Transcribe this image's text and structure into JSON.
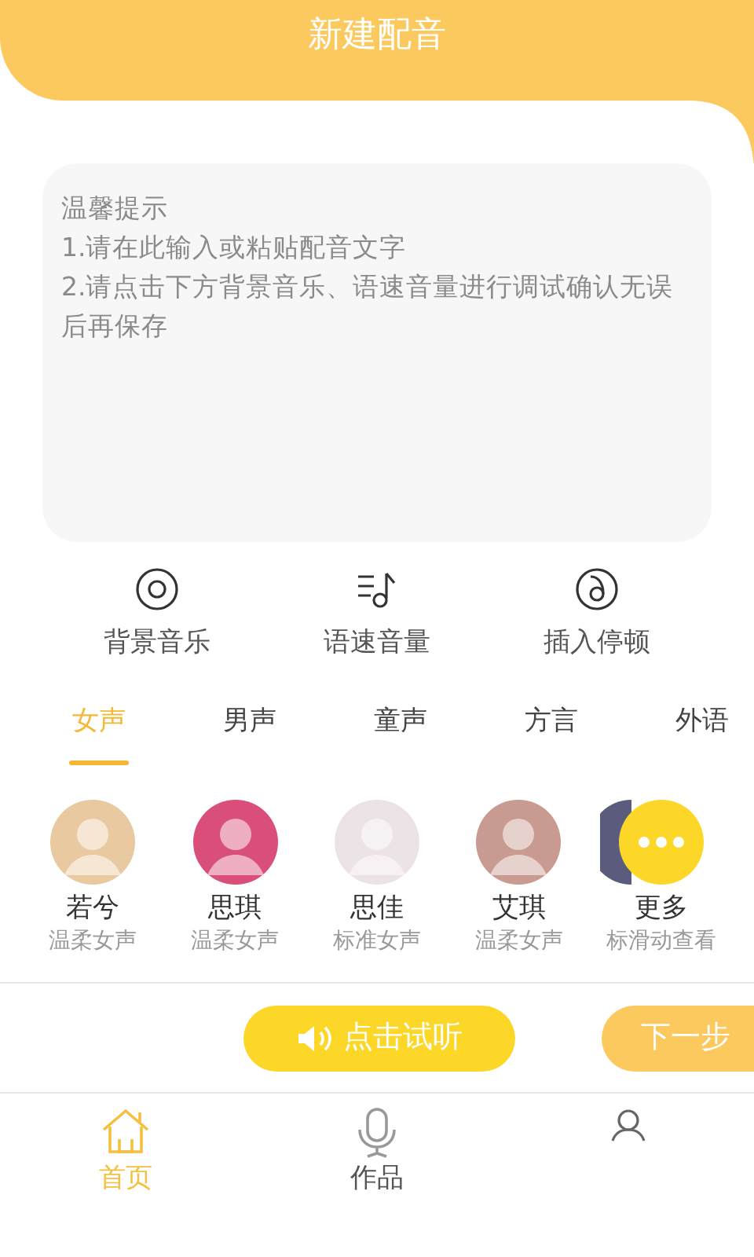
{
  "header": {
    "title": "新建配音"
  },
  "editor": {
    "placeholder": "温馨提示\n1.请在此输入或粘贴配音文字\n2.请点击下方背景音乐、语速音量进行调试确认无误后再保存"
  },
  "tools": [
    {
      "kind": "music",
      "label": "背景音乐"
    },
    {
      "kind": "speed",
      "label": "语速音量"
    },
    {
      "kind": "pause",
      "label": "插入停顿"
    }
  ],
  "tabs": [
    {
      "label": "女声",
      "selected": true
    },
    {
      "label": "男声",
      "selected": false
    },
    {
      "label": "童声",
      "selected": false
    },
    {
      "label": "方言",
      "selected": false
    },
    {
      "label": "外语",
      "selected": false
    }
  ],
  "voices": [
    {
      "kind": "voice",
      "name": "若兮",
      "style": "温柔女声",
      "color": "#e8c9a0"
    },
    {
      "kind": "voice",
      "name": "思琪",
      "style": "温柔女声",
      "color": "#d94f7a"
    },
    {
      "kind": "voice",
      "name": "思佳",
      "style": "标准女声",
      "color": "#ece3e6"
    },
    {
      "kind": "voice",
      "name": "艾琪",
      "style": "温柔女声",
      "color": "#c99a8f"
    },
    {
      "kind": "more",
      "name": "更多",
      "style": "标滑动查看",
      "color": "#5a5b7d"
    }
  ],
  "actions": [
    {
      "kind": "listen",
      "label": "点击试听"
    },
    {
      "kind": "next",
      "label": "下一步"
    }
  ],
  "nav": [
    {
      "kind": "home",
      "label": "首页",
      "selected": true
    },
    {
      "kind": "mic",
      "label": "作品",
      "selected": false
    },
    {
      "kind": "person",
      "selected": false
    }
  ]
}
